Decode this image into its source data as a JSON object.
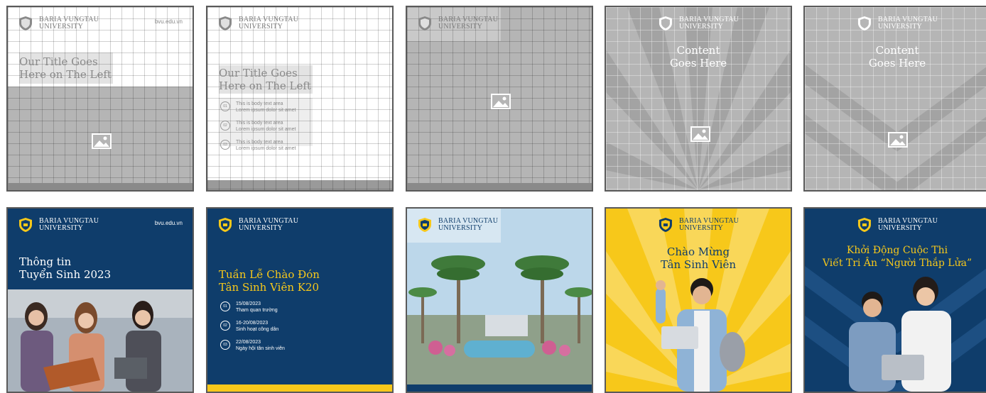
{
  "brand": {
    "logo_line1": "BARIA VUNGTAU",
    "logo_line2": "UNIVERSITY",
    "url": "bvu.edu.vn",
    "navy": "#0f3d6b",
    "yellow": "#f7c81a",
    "gray": "#b3b3b3"
  },
  "templates": {
    "t1_title_l1": "Our Title Goes",
    "t1_title_l2": "Here on The Left",
    "t2_title_l1": "Our Title Goes",
    "t2_title_l2": "Here on The Left",
    "t2_items": [
      {
        "num": "01",
        "l1": "This is body text area",
        "l2": "Lorem ipsum dolor sit amet"
      },
      {
        "num": "02",
        "l1": "This is body text area",
        "l2": "Lorem ipsum dolor sit amet"
      },
      {
        "num": "03",
        "l1": "This is body text area",
        "l2": "Lorem ipsum dolor sit amet"
      }
    ],
    "t4_title_l1": "Content",
    "t4_title_l2": "Goes Here",
    "t5_title_l1": "Content",
    "t5_title_l2": "Goes Here"
  },
  "examples": {
    "e1_title_l1": "Thông tin",
    "e1_title_l2": "Tuyển Sinh 2023",
    "e2_title_l1": "Tuần Lễ Chào Đón",
    "e2_title_l2": "Tân Sinh Viên K20",
    "e2_items": [
      {
        "num": "01",
        "l1": "15/08/2023",
        "l2": "Tham quan trường"
      },
      {
        "num": "02",
        "l1": "16-20/08/2023",
        "l2": "Sinh hoạt công dân"
      },
      {
        "num": "03",
        "l1": "22/08/2023",
        "l2": "Ngày hội tân sinh viên"
      }
    ],
    "e4_title_l1": "Chào Mừng",
    "e4_title_l2": "Tân Sinh Viên",
    "e5_title_l1": "Khởi Động Cuộc Thi",
    "e5_title_l2": "Viết Tri Ân “Người Thắp Lửa”"
  },
  "icons": [
    "shield-logo-icon",
    "image-placeholder-icon"
  ]
}
